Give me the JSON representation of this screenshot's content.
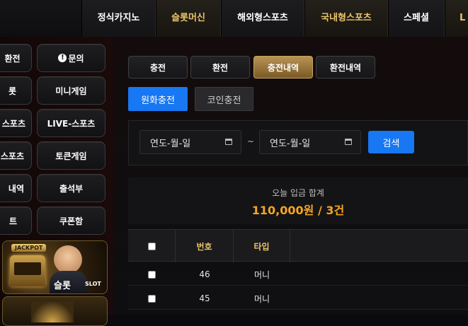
{
  "topnav": {
    "items": [
      {
        "label": "정식카지노",
        "accent": "white"
      },
      {
        "label": "슬롯머신",
        "accent": "gold"
      },
      {
        "label": "해외형스포츠",
        "accent": "white"
      },
      {
        "label": "국내형스포츠",
        "accent": "gold"
      },
      {
        "label": "스페셜",
        "accent": "white"
      },
      {
        "label": "L",
        "accent": "gold"
      }
    ]
  },
  "sidebar": {
    "left_col": [
      "환전",
      "롯",
      "스포츠",
      "스포츠",
      "내역",
      "트"
    ],
    "right_col": [
      "문의",
      "미니게임",
      "LIVE-스포츠",
      "토큰게임",
      "출석부",
      "쿠폰함"
    ],
    "help_icon": "!",
    "banner": {
      "badge": "JACKPOT",
      "title": "슬롯",
      "sub": "SLOT"
    }
  },
  "tabs": [
    "충전",
    "환전",
    "충전내역",
    "환전내역"
  ],
  "active_tab": 2,
  "subtabs": [
    "원화충전",
    "코인충전"
  ],
  "search": {
    "start_date": "연도-월-일",
    "separator": "~",
    "end_date": "연도-월-일",
    "button": "검색"
  },
  "summary": {
    "label": "오늘 입금 합계",
    "value": "110,000원 / 3건"
  },
  "table": {
    "headers": [
      "번호",
      "타입"
    ],
    "rows": [
      {
        "no": "46",
        "type": "머니"
      },
      {
        "no": "45",
        "type": "머니"
      }
    ]
  },
  "colors": {
    "accent_gold": "#e9c46a",
    "primary_blue": "#1877f2",
    "sum_orange": "#f5a623"
  }
}
